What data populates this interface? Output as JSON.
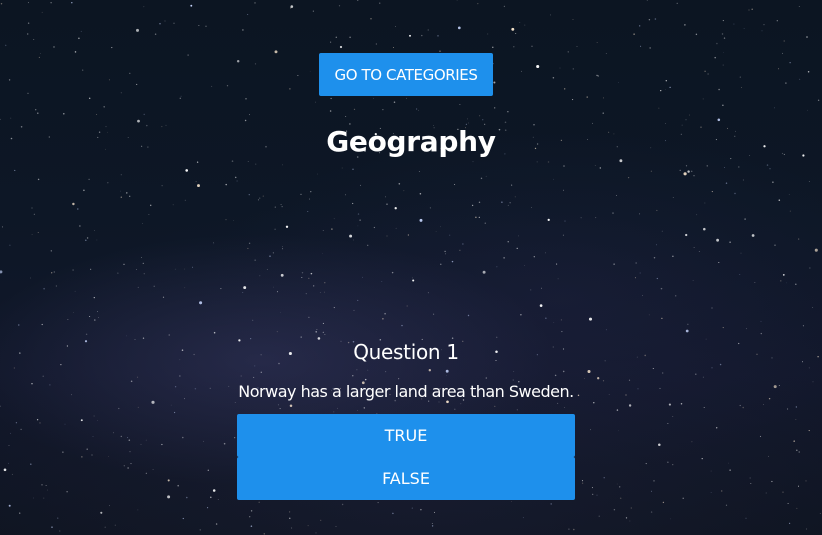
{
  "header": {
    "categories_button_label": "GO TO CATEGORIES"
  },
  "category": {
    "title": "Geography"
  },
  "question": {
    "number_label": "Question 1",
    "text": "Norway has a larger land area than Sweden."
  },
  "answers": {
    "true_label": "TRUE",
    "false_label": "FALSE"
  },
  "theme": {
    "accent": "#1e90ec",
    "background": "#0d1726",
    "text": "#ffffff"
  },
  "background_image": {
    "icon": "starry-night-sky"
  }
}
